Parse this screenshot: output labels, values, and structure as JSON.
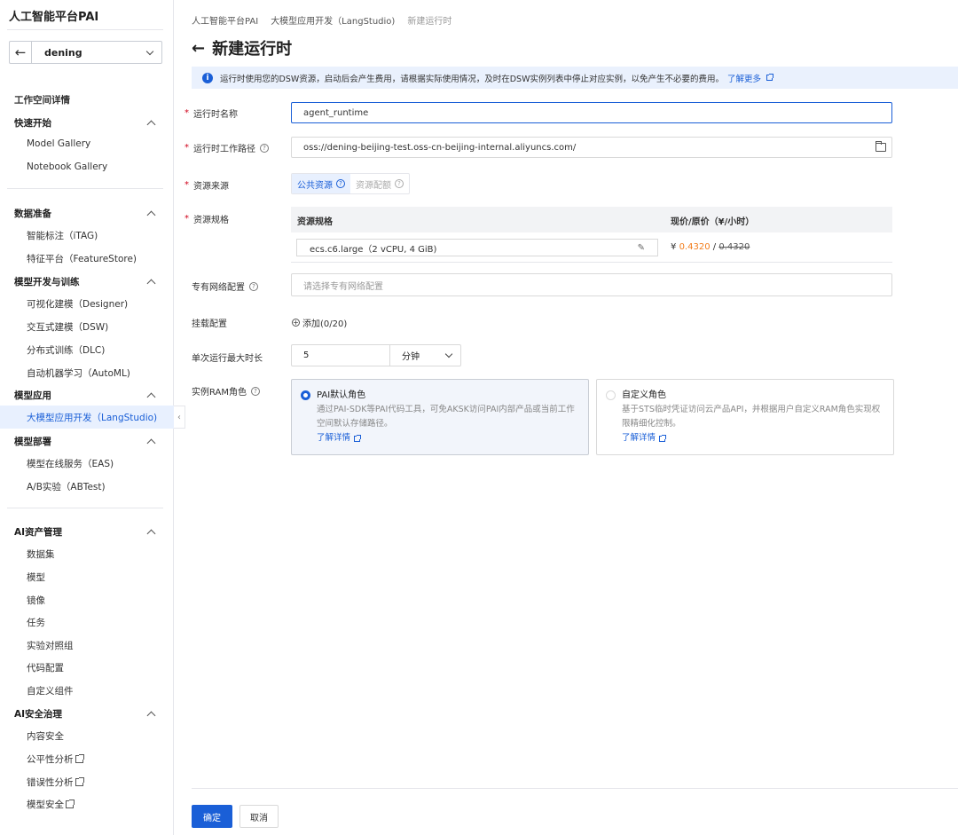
{
  "sidebar": {
    "brand": "人工智能平台PAI",
    "workspace": "dening",
    "workspace_detail": "工作空间详情",
    "sections": [
      {
        "title": "快速开始",
        "items": [
          "Model Gallery",
          "Notebook Gallery"
        ]
      },
      {
        "title": "数据准备",
        "items": [
          "智能标注（iTAG)",
          "特征平台（FeatureStore)"
        ]
      },
      {
        "title": "模型开发与训练",
        "items": [
          "可视化建模（Designer)",
          "交互式建模（DSW)",
          "分布式训练（DLC)",
          "自动机器学习（AutoML)"
        ]
      },
      {
        "title": "模型应用",
        "items": [
          "大模型应用开发（LangStudio)"
        ]
      },
      {
        "title": "模型部署",
        "items": [
          "模型在线服务（EAS)",
          "A/B实验（ABTest)"
        ]
      },
      {
        "title": "AI资产管理",
        "items": [
          "数据集",
          "模型",
          "镜像",
          "任务",
          "实验对照组",
          "代码配置",
          "自定义组件"
        ]
      },
      {
        "title": "AI安全治理",
        "items": [
          "内容安全",
          "公平性分析",
          "错误性分析",
          "模型安全"
        ]
      }
    ]
  },
  "breadcrumb": [
    "人工智能平台PAI",
    "大模型应用开发（LangStudio)",
    "新建运行时"
  ],
  "page_title": "新建运行时",
  "notice": {
    "text": "运行时使用您的DSW资源，启动后会产生费用，请根据实际使用情况，及时在DSW实例列表中停止对应实例，以免产生不必要的费用。",
    "link": "了解更多"
  },
  "form": {
    "name_label": "运行时名称",
    "name_value": "agent_runtime",
    "path_label": "运行时工作路径",
    "path_value": "oss://dening-beijing-test.oss-cn-beijing-internal.aliyuncs.com/",
    "source_label": "资源来源",
    "source_options": [
      "公共资源",
      "资源配额"
    ],
    "spec_label": "资源规格",
    "spec_col1": "资源规格",
    "spec_col2": "现价/原价（¥/小时）",
    "spec_value": "ecs.c6.large（2 vCPU, 4 GiB)",
    "price_symbol": "¥",
    "price_now": "0.4320",
    "price_sep": "/",
    "price_orig": "0.4320",
    "vpc_label": "专有网络配置",
    "vpc_placeholder": "请选择专有网络配置",
    "mount_label": "挂载配置",
    "mount_add": "添加(0/20)",
    "duration_label": "单次运行最大时长",
    "duration_value": "5",
    "duration_unit": "分钟",
    "ram_label": "实例RAM角色",
    "ram_default_title": "PAI默认角色",
    "ram_default_desc": "通过PAI-SDK等PAI代码工具，可免AKSK访问PAI内部产品或当前工作空间默认存储路径。",
    "ram_custom_title": "自定义角色",
    "ram_custom_desc": "基于STS临时凭证访问云产品API，并根据用户自定义RAM角色实现权限精细化控制。",
    "learn_more": "了解详情"
  },
  "footer": {
    "confirm": "确定",
    "cancel": "取消"
  }
}
